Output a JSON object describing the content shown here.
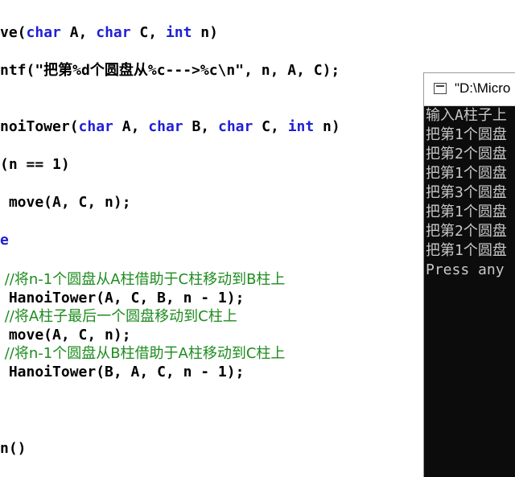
{
  "editor": {
    "lines": [
      {
        "id": "l0",
        "parts": [
          "ve(",
          "char",
          " A, ",
          "char",
          " C, ",
          "int",
          " n)"
        ]
      },
      {
        "id": "l1",
        "text": "ntf(\"把第%d个圆盘从%c--->%c\\n\", n, A, C);"
      },
      {
        "id": "l2",
        "parts": [
          "noiTower(",
          "char",
          " A, ",
          "char",
          " B, ",
          "char",
          " C, ",
          "int",
          " n)"
        ]
      },
      {
        "id": "l3",
        "text": "(n == 1)"
      },
      {
        "id": "l4",
        "text": " move(A, C, n);"
      },
      {
        "id": "l5",
        "text": "e"
      },
      {
        "id": "l6",
        "text": " //将n-1个圆盘从A柱借助于C柱移动到B柱上"
      },
      {
        "id": "l7",
        "text": " HanoiTower(A, C, B, n - 1);"
      },
      {
        "id": "l8",
        "text": " //将A柱子最后一个圆盘移动到C柱上"
      },
      {
        "id": "l9",
        "text": " move(A, C, n);"
      },
      {
        "id": "l10",
        "text": " //将n-1个圆盘从B柱借助于A柱移动到C柱上"
      },
      {
        "id": "l11",
        "text": " HanoiTower(B, A, C, n - 1);"
      },
      {
        "id": "l12",
        "text": "n()"
      }
    ]
  },
  "console": {
    "title": "\"D:\\Micro",
    "icon": "console-window-icon",
    "output": [
      "输入A柱子上",
      "把第1个圆盘",
      "把第2个圆盘",
      "把第1个圆盘",
      "把第3个圆盘",
      "把第1个圆盘",
      "把第2个圆盘",
      "把第1个圆盘",
      "Press any "
    ]
  },
  "colors": {
    "keyword": "#1f1fd6",
    "comment": "#1e8c1e",
    "console_bg": "#0c0c0c",
    "console_text": "#c8c8c8"
  }
}
